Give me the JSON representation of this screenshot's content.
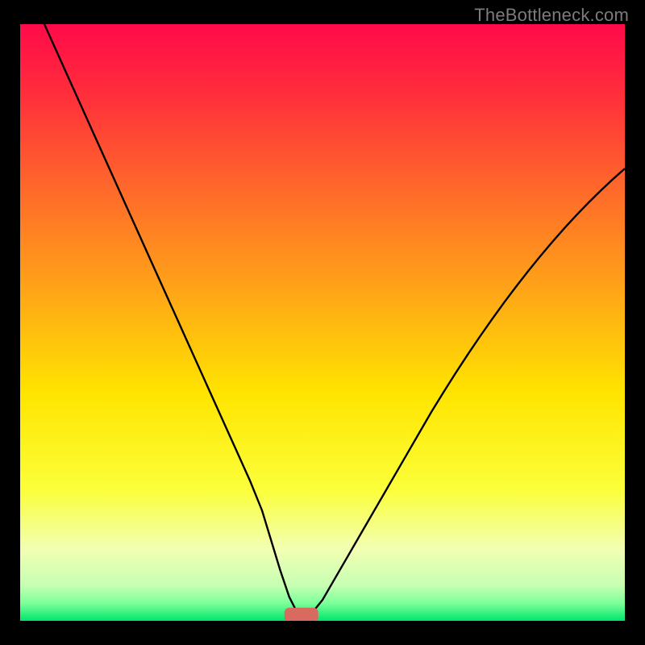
{
  "watermark": "TheBottleneck.com",
  "chart_data": {
    "type": "line",
    "title": "",
    "xlabel": "",
    "ylabel": "",
    "xlim": [
      0,
      100
    ],
    "ylim": [
      0,
      100
    ],
    "background_gradient": {
      "stops": [
        {
          "offset": 0.0,
          "color": "#ff0a4a"
        },
        {
          "offset": 0.12,
          "color": "#ff2f3b"
        },
        {
          "offset": 0.28,
          "color": "#ff6a2a"
        },
        {
          "offset": 0.45,
          "color": "#ffa617"
        },
        {
          "offset": 0.62,
          "color": "#ffe500"
        },
        {
          "offset": 0.78,
          "color": "#fbff3a"
        },
        {
          "offset": 0.88,
          "color": "#f2ffb3"
        },
        {
          "offset": 0.94,
          "color": "#c7ffb3"
        },
        {
          "offset": 0.97,
          "color": "#7eff9a"
        },
        {
          "offset": 1.0,
          "color": "#00e66b"
        }
      ]
    },
    "series": [
      {
        "name": "curve",
        "color": "#000000",
        "x": [
          4,
          6,
          8,
          10,
          12,
          14,
          16,
          18,
          20,
          22,
          24,
          26,
          28,
          30,
          32,
          34,
          36,
          38,
          40,
          41.5,
          43,
          44.5,
          46,
          48,
          50,
          52,
          54,
          56,
          58,
          60,
          62,
          64,
          66,
          68,
          70,
          72,
          74,
          76,
          78,
          80,
          82,
          84,
          86,
          88,
          90,
          92,
          94,
          96,
          98,
          100
        ],
        "y": [
          100,
          95.5,
          91,
          86.5,
          82,
          77.5,
          73,
          68.5,
          64,
          59.5,
          55,
          50.5,
          46,
          41.5,
          37,
          32.5,
          28,
          23.5,
          18.5,
          13.5,
          8.5,
          4.0,
          1.0,
          1.0,
          3.5,
          7.0,
          10.5,
          14.0,
          17.5,
          21.0,
          24.5,
          28.0,
          31.5,
          35.0,
          38.3,
          41.5,
          44.6,
          47.6,
          50.5,
          53.3,
          56.0,
          58.6,
          61.1,
          63.5,
          65.8,
          68.0,
          70.1,
          72.1,
          74.0,
          75.8
        ]
      }
    ],
    "marker": {
      "shape": "rounded-rect",
      "color": "#d86a5f",
      "cx": 46.5,
      "cy": 1.0,
      "rx": 2.8,
      "ry": 1.2
    }
  }
}
